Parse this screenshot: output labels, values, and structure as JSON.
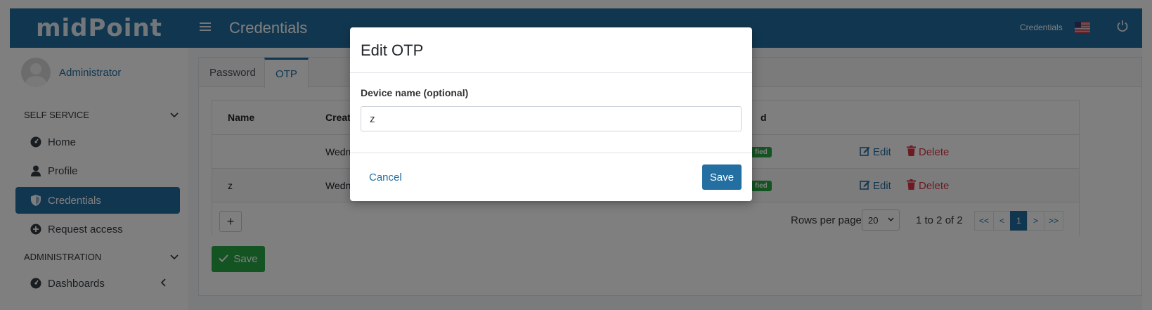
{
  "header": {
    "logo_text": "midPoint",
    "title": "Credentials",
    "right_link": "Credentials",
    "flag_icon": "us-flag-icon",
    "power_icon": "power-icon",
    "brand_color": "#236fa1"
  },
  "sidebar": {
    "user_name": "Administrator",
    "sections": [
      {
        "label": "SELF SERVICE"
      },
      {
        "label": "ADMINISTRATION"
      }
    ],
    "items": [
      {
        "label": "Home",
        "icon": "dashboard-icon"
      },
      {
        "label": "Profile",
        "icon": "user-icon"
      },
      {
        "label": "Credentials",
        "icon": "shield-icon",
        "active": true
      },
      {
        "label": "Request access",
        "icon": "plus-circle-icon"
      },
      {
        "label": "Dashboards",
        "icon": "dashboard-icon"
      }
    ]
  },
  "tabs": [
    {
      "label": "Password"
    },
    {
      "label": "OTP",
      "active": true
    }
  ],
  "table": {
    "columns": [
      "Name",
      "Create",
      "d"
    ],
    "rows": [
      {
        "name": "",
        "created": "Wednes",
        "status": "fied",
        "edit": "Edit",
        "delete": "Delete"
      },
      {
        "name": "z",
        "created": "Wednes",
        "status": "fied",
        "edit": "Edit",
        "delete": "Delete"
      }
    ],
    "add_button": "+",
    "rows_per_page_label": "Rows per page",
    "rows_per_page_value": "20",
    "range_text": "1 to 2 of 2",
    "pager": [
      "<<",
      "<",
      "1",
      ">",
      ">>"
    ]
  },
  "save_button": "Save",
  "modal": {
    "title": "Edit OTP",
    "field_label": "Device name (optional)",
    "field_value": "z",
    "cancel": "Cancel",
    "save": "Save"
  }
}
